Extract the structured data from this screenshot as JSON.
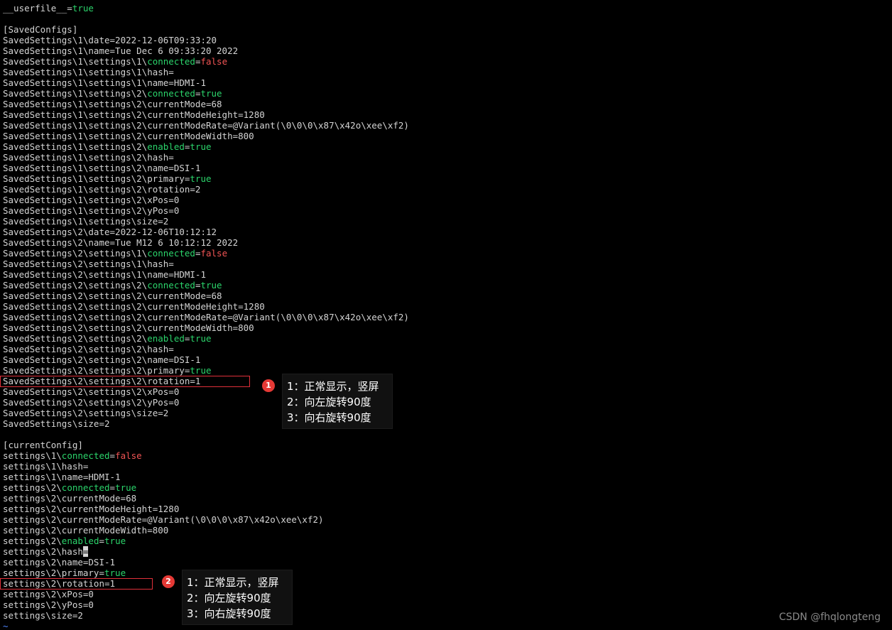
{
  "terminal": {
    "lines": [
      [
        {
          "t": "__userfile__="
        },
        {
          "t": "true",
          "c": "green"
        }
      ],
      [],
      [
        {
          "t": "[SavedConfigs]"
        }
      ],
      [
        {
          "t": "SavedSettings\\1\\date=2022-12-06T09:33:20"
        }
      ],
      [
        {
          "t": "SavedSettings\\1\\name=Tue Dec 6 09:33:20 2022"
        }
      ],
      [
        {
          "t": "SavedSettings\\1\\settings\\1\\"
        },
        {
          "t": "connected",
          "c": "green"
        },
        {
          "t": "="
        },
        {
          "t": "false",
          "c": "red"
        }
      ],
      [
        {
          "t": "SavedSettings\\1\\settings\\1\\hash="
        }
      ],
      [
        {
          "t": "SavedSettings\\1\\settings\\1\\name=HDMI-1"
        }
      ],
      [
        {
          "t": "SavedSettings\\1\\settings\\2\\"
        },
        {
          "t": "connected",
          "c": "green"
        },
        {
          "t": "="
        },
        {
          "t": "true",
          "c": "green"
        }
      ],
      [
        {
          "t": "SavedSettings\\1\\settings\\2\\currentMode=68"
        }
      ],
      [
        {
          "t": "SavedSettings\\1\\settings\\2\\currentModeHeight=1280"
        }
      ],
      [
        {
          "t": "SavedSettings\\1\\settings\\2\\currentModeRate=@Variant(\\0\\0\\0\\x87\\x42o\\xee\\xf2)"
        }
      ],
      [
        {
          "t": "SavedSettings\\1\\settings\\2\\currentModeWidth=800"
        }
      ],
      [
        {
          "t": "SavedSettings\\1\\settings\\2\\"
        },
        {
          "t": "enabled",
          "c": "green"
        },
        {
          "t": "="
        },
        {
          "t": "true",
          "c": "green"
        }
      ],
      [
        {
          "t": "SavedSettings\\1\\settings\\2\\hash="
        }
      ],
      [
        {
          "t": "SavedSettings\\1\\settings\\2\\name=DSI-1"
        }
      ],
      [
        {
          "t": "SavedSettings\\1\\settings\\2\\primary="
        },
        {
          "t": "true",
          "c": "green"
        }
      ],
      [
        {
          "t": "SavedSettings\\1\\settings\\2\\rotation=2"
        }
      ],
      [
        {
          "t": "SavedSettings\\1\\settings\\2\\xPos=0"
        }
      ],
      [
        {
          "t": "SavedSettings\\1\\settings\\2\\yPos=0"
        }
      ],
      [
        {
          "t": "SavedSettings\\1\\settings\\size=2"
        }
      ],
      [
        {
          "t": "SavedSettings\\2\\date=2022-12-06T10:12:12"
        }
      ],
      [
        {
          "t": "SavedSettings\\2\\name=Tue M12 6 10:12:12 2022"
        }
      ],
      [
        {
          "t": "SavedSettings\\2\\settings\\1\\"
        },
        {
          "t": "connected",
          "c": "green"
        },
        {
          "t": "="
        },
        {
          "t": "false",
          "c": "red"
        }
      ],
      [
        {
          "t": "SavedSettings\\2\\settings\\1\\hash="
        }
      ],
      [
        {
          "t": "SavedSettings\\2\\settings\\1\\name=HDMI-1"
        }
      ],
      [
        {
          "t": "SavedSettings\\2\\settings\\2\\"
        },
        {
          "t": "connected",
          "c": "green"
        },
        {
          "t": "="
        },
        {
          "t": "true",
          "c": "green"
        }
      ],
      [
        {
          "t": "SavedSettings\\2\\settings\\2\\currentMode=68"
        }
      ],
      [
        {
          "t": "SavedSettings\\2\\settings\\2\\currentModeHeight=1280"
        }
      ],
      [
        {
          "t": "SavedSettings\\2\\settings\\2\\currentModeRate=@Variant(\\0\\0\\0\\x87\\x42o\\xee\\xf2)"
        }
      ],
      [
        {
          "t": "SavedSettings\\2\\settings\\2\\currentModeWidth=800"
        }
      ],
      [
        {
          "t": "SavedSettings\\2\\settings\\2\\"
        },
        {
          "t": "enabled",
          "c": "green"
        },
        {
          "t": "="
        },
        {
          "t": "true",
          "c": "green"
        }
      ],
      [
        {
          "t": "SavedSettings\\2\\settings\\2\\hash="
        }
      ],
      [
        {
          "t": "SavedSettings\\2\\settings\\2\\name=DSI-1"
        }
      ],
      [
        {
          "t": "SavedSettings\\2\\settings\\2\\primary="
        },
        {
          "t": "true",
          "c": "green"
        }
      ],
      [
        {
          "t": "SavedSettings\\2\\settings\\2\\rotation=1"
        }
      ],
      [
        {
          "t": "SavedSettings\\2\\settings\\2\\xPos=0"
        }
      ],
      [
        {
          "t": "SavedSettings\\2\\settings\\2\\yPos=0"
        }
      ],
      [
        {
          "t": "SavedSettings\\2\\settings\\size=2"
        }
      ],
      [
        {
          "t": "SavedSettings\\size=2"
        }
      ],
      [],
      [
        {
          "t": "[currentConfig]"
        }
      ],
      [
        {
          "t": "settings\\1\\"
        },
        {
          "t": "connected",
          "c": "green"
        },
        {
          "t": "="
        },
        {
          "t": "false",
          "c": "red"
        }
      ],
      [
        {
          "t": "settings\\1\\hash="
        }
      ],
      [
        {
          "t": "settings\\1\\name=HDMI-1"
        }
      ],
      [
        {
          "t": "settings\\2\\"
        },
        {
          "t": "connected",
          "c": "green"
        },
        {
          "t": "="
        },
        {
          "t": "true",
          "c": "green"
        }
      ],
      [
        {
          "t": "settings\\2\\currentMode=68"
        }
      ],
      [
        {
          "t": "settings\\2\\currentModeHeight=1280"
        }
      ],
      [
        {
          "t": "settings\\2\\currentModeRate=@Variant(\\0\\0\\0\\x87\\x42o\\xee\\xf2)"
        }
      ],
      [
        {
          "t": "settings\\2\\currentModeWidth=800"
        }
      ],
      [
        {
          "t": "settings\\2\\"
        },
        {
          "t": "enabled",
          "c": "green"
        },
        {
          "t": "="
        },
        {
          "t": "true",
          "c": "green"
        }
      ],
      [
        {
          "t": "settings\\2\\hash"
        },
        {
          "t": "=",
          "c": "cursor"
        }
      ],
      [
        {
          "t": "settings\\2\\name=DSI-1"
        }
      ],
      [
        {
          "t": "settings\\2\\primary="
        },
        {
          "t": "true",
          "c": "green"
        }
      ],
      [
        {
          "t": "settings\\2\\rotation=1"
        }
      ],
      [
        {
          "t": "settings\\2\\xPos=0"
        }
      ],
      [
        {
          "t": "settings\\2\\yPos=0"
        }
      ],
      [
        {
          "t": "settings\\size=2"
        }
      ],
      [
        {
          "t": "~",
          "c": "tilde"
        }
      ]
    ]
  },
  "annotations": [
    {
      "badge": "1",
      "notes": [
        "1：正常显示，竖屏",
        "2：向左旋转90度",
        "3：向右旋转90度"
      ]
    },
    {
      "badge": "2",
      "notes": [
        "1：正常显示，竖屏",
        "2：向左旋转90度",
        "3：向右旋转90度"
      ]
    }
  ],
  "watermark": "CSDN @fhqlongteng",
  "colors": {
    "background": "#000000",
    "text": "#d4d4d4",
    "keyword_green": "#2bd46b",
    "value_red": "#f05454",
    "highlight_box": "#e0303a",
    "badge": "#e53935"
  }
}
